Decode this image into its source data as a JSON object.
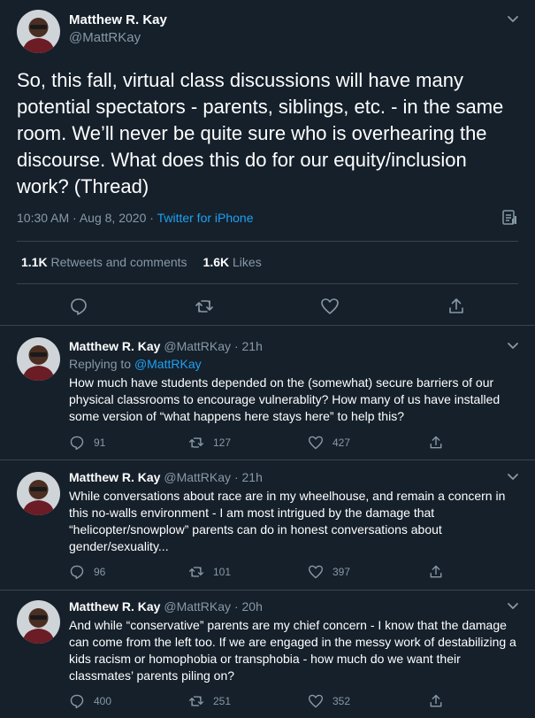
{
  "main_tweet": {
    "author_name": "Matthew R. Kay",
    "author_handle": "@MattRKay",
    "text": "So, this fall, virtual class discussions will have many potential spectators - parents, siblings, etc. - in the same room. We’ll never be quite sure who is overhearing the discourse. What does this do for our equity/inclusion work? (Thread)",
    "time": "10:30 AM",
    "date": "Aug 8, 2020",
    "meta_separator": "·",
    "source": "Twitter for iPhone",
    "retweets_count": "1.1K",
    "retweets_label": "Retweets and comments",
    "likes_count": "1.6K",
    "likes_label": "Likes"
  },
  "replies": [
    {
      "author_name": "Matthew R. Kay",
      "author_handle": "@MattRKay",
      "age": "21h",
      "replying_prefix": "Replying to",
      "replying_to": "@MattRKay",
      "text": "How much have students depended on the (somewhat) secure barriers of our physical classrooms to encourage vulnerablity? How many of us have installed some version of “what happens here stays here” to help this?",
      "reply_count": "91",
      "retweet_count": "127",
      "like_count": "427"
    },
    {
      "author_name": "Matthew R. Kay",
      "author_handle": "@MattRKay",
      "age": "21h",
      "text": "While conversations about race are in my wheelhouse, and remain a concern in this no-walls environment - I am most intrigued by the damage that “helicopter/snowplow” parents can do in honest conversations about gender/sexuality...",
      "reply_count": "96",
      "retweet_count": "101",
      "like_count": "397"
    },
    {
      "author_name": "Matthew R. Kay",
      "author_handle": "@MattRKay",
      "age": "20h",
      "text": "And while “conservative” parents are my chief concern - I know that the damage can come from the left too. If we are engaged in the messy work of destabilizing a kids racism or homophobia or transphobia - how much do we want their classmates’ parents piling on?",
      "reply_count": "400",
      "retweet_count": "251",
      "like_count": "352"
    }
  ],
  "icons": {
    "avatar": "avatar-photo",
    "more": "chevron-down-icon",
    "analytics": "analytics-icon",
    "reply": "reply-icon",
    "retweet": "retweet-icon",
    "like": "heart-icon",
    "share": "share-icon"
  },
  "colors": {
    "background": "#15202b",
    "text": "#ffffff",
    "muted": "#8899a6",
    "link": "#1da1f2",
    "divider": "#38444d"
  }
}
